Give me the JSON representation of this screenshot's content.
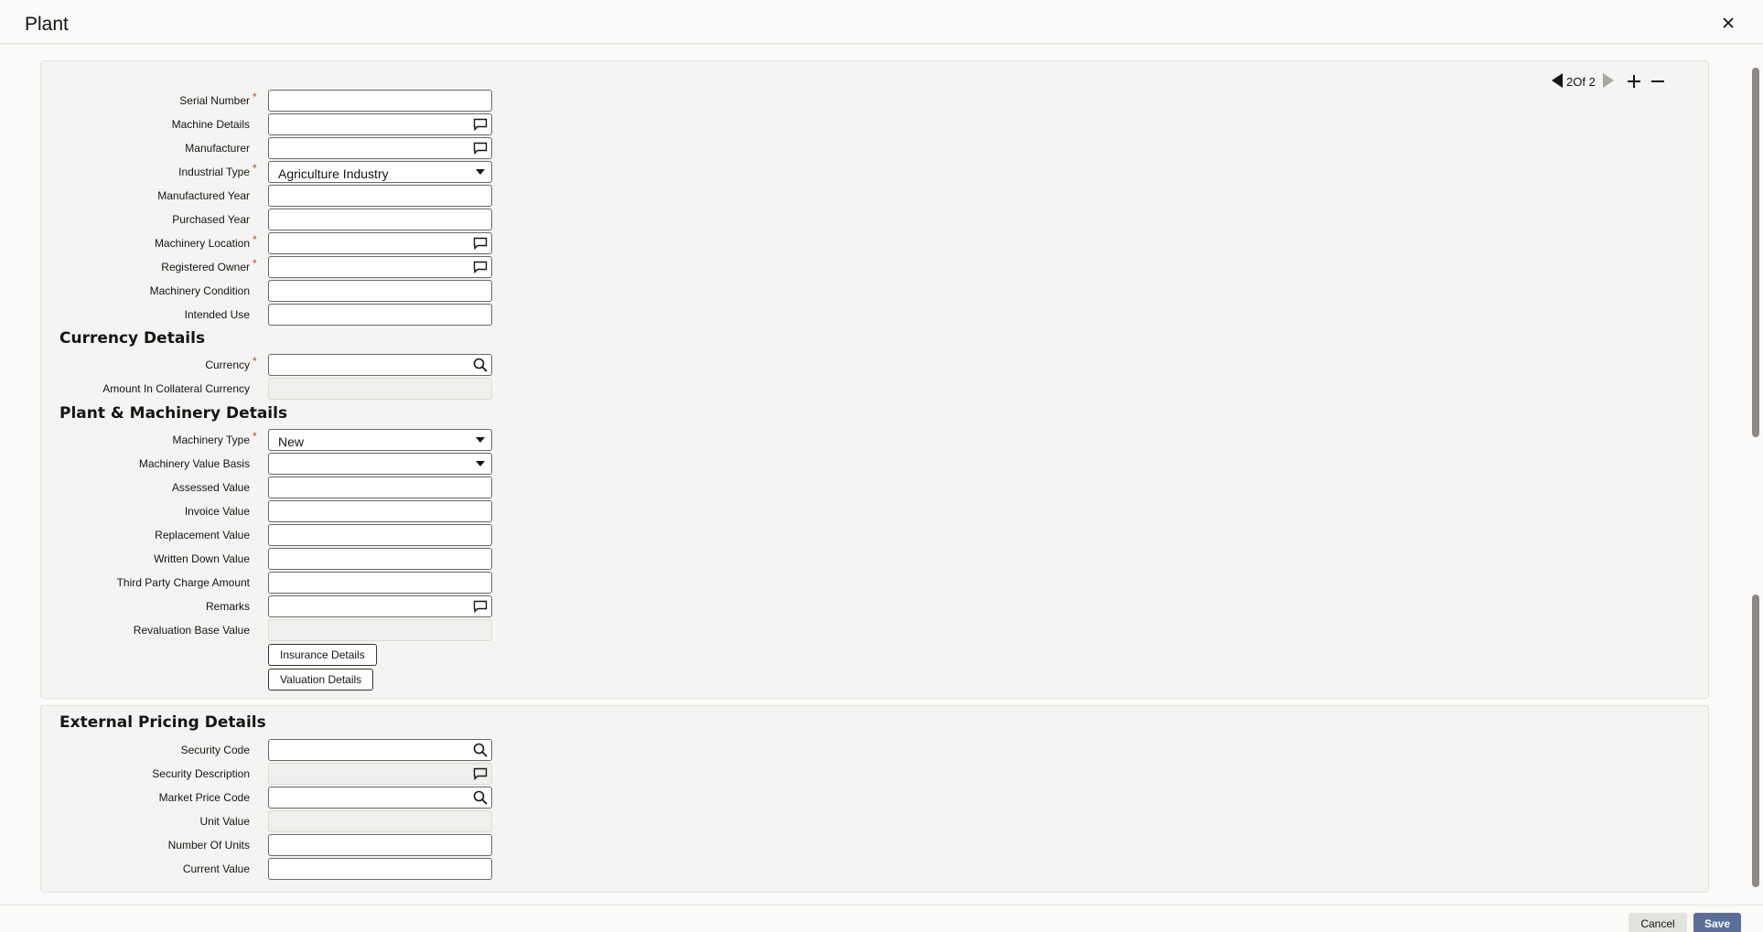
{
  "window": {
    "title": "Plant"
  },
  "nav": {
    "page_indicator": "2Of 2"
  },
  "form": {
    "serial_number": {
      "label": "Serial Number",
      "value": ""
    },
    "machine_details": {
      "label": "Machine Details",
      "value": ""
    },
    "manufacturer": {
      "label": "Manufacturer",
      "value": ""
    },
    "industrial_type": {
      "label": "Industrial Type",
      "value": "Agriculture Industry"
    },
    "manufactured_year": {
      "label": "Manufactured Year",
      "value": ""
    },
    "purchased_year": {
      "label": "Purchased Year",
      "value": ""
    },
    "machinery_location": {
      "label": "Machinery Location",
      "value": ""
    },
    "registered_owner": {
      "label": "Registered Owner",
      "value": ""
    },
    "machinery_condition": {
      "label": "Machinery Condition",
      "value": ""
    },
    "intended_use": {
      "label": "Intended Use",
      "value": ""
    }
  },
  "currency_details": {
    "heading": "Currency Details",
    "currency": {
      "label": "Currency",
      "value": ""
    },
    "amount_in_collateral_currency": {
      "label": "Amount In Collateral Currency",
      "value": ""
    }
  },
  "plant_machinery": {
    "heading": "Plant & Machinery Details",
    "machinery_type": {
      "label": "Machinery Type",
      "value": "New"
    },
    "machinery_value_basis": {
      "label": "Machinery Value Basis",
      "value": ""
    },
    "assessed_value": {
      "label": "Assessed Value",
      "value": ""
    },
    "invoice_value": {
      "label": "Invoice Value",
      "value": ""
    },
    "replacement_value": {
      "label": "Replacement Value",
      "value": ""
    },
    "written_down_value": {
      "label": "Written Down Value",
      "value": ""
    },
    "third_party_charge_amount": {
      "label": "Third Party Charge Amount",
      "value": ""
    },
    "remarks": {
      "label": "Remarks",
      "value": ""
    },
    "revaluation_base_value": {
      "label": "Revaluation Base Value",
      "value": ""
    },
    "insurance_details_button": "Insurance Details",
    "valuation_details_button": "Valuation Details"
  },
  "external_pricing": {
    "heading": "External Pricing Details",
    "security_code": {
      "label": "Security Code",
      "value": ""
    },
    "security_description": {
      "label": "Security Description",
      "value": ""
    },
    "market_price_code": {
      "label": "Market Price Code",
      "value": ""
    },
    "unit_value": {
      "label": "Unit Value",
      "value": ""
    },
    "number_of_units": {
      "label": "Number Of Units",
      "value": ""
    },
    "current_value": {
      "label": "Current Value",
      "value": ""
    }
  },
  "footer": {
    "cancel_label": "Cancel",
    "save_label": "Save"
  },
  "colors": {
    "accent": "#5b6e9a",
    "required": "#d63b25"
  },
  "icons": {
    "lov": "chat-bubble-icon",
    "search": "search-icon",
    "dropdown": "caret-down-icon"
  }
}
